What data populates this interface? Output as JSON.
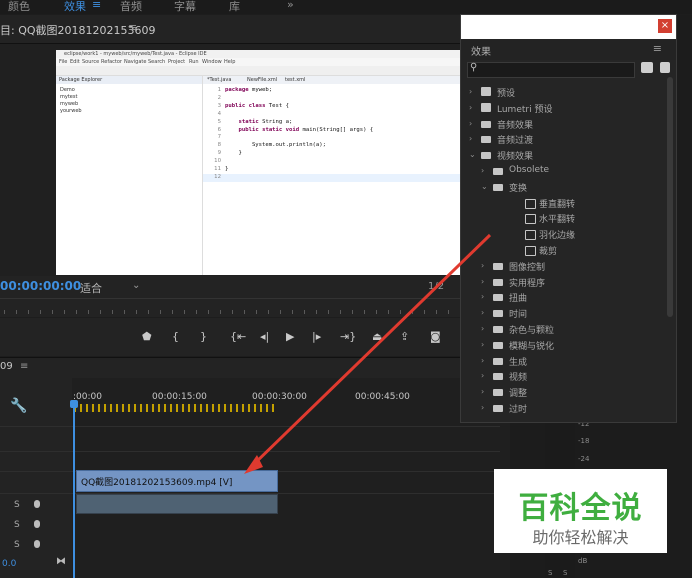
{
  "workspace_tabs": [
    {
      "label": "颜色",
      "active": false
    },
    {
      "label": "效果",
      "active": true
    },
    {
      "label": "音频",
      "active": false
    },
    {
      "label": "字幕",
      "active": false
    },
    {
      "label": "库",
      "active": false
    }
  ],
  "workspace_more": "»",
  "program_monitor": {
    "title": "目: QQ截图20181202153609",
    "menu_icon": "≡",
    "timecode": "00:00:00:00",
    "fit": "适合",
    "ratio": "1/2"
  },
  "eclipse": {
    "title": "eclipse/work1 - myweb/src/myweb/Test.java - Eclipse IDE",
    "menu": [
      "File",
      "Edit",
      "Source",
      "Refactor",
      "Navigate",
      "Search",
      "Project",
      "Run",
      "Window",
      "Help"
    ],
    "package_explorer": "Package Explorer",
    "projects": [
      "Demo",
      "mytest",
      "myweb",
      "yourweb"
    ],
    "tabs": [
      "*Test.java",
      "NewFile.xml",
      "test.xml"
    ],
    "line_numbers": [
      "1",
      "2",
      "3",
      "4",
      "5",
      "6",
      "7",
      "8",
      "9",
      "10",
      "11",
      "12"
    ],
    "code_lines": [
      "package myweb;",
      "",
      "public class Test {",
      "",
      "    static String a;",
      "    public static void main(String[] args) {",
      "",
      "        System.out.println(a);",
      "    }",
      "",
      "}",
      ""
    ]
  },
  "timeline": {
    "sequence_label": "09",
    "menu_icon": "≡",
    "timestamps": [
      ":00:00",
      "00:00:15:00",
      "00:00:30:00",
      "00:00:45:00"
    ],
    "video_clip": "QQ截图20181202153609.mp4 [V]",
    "track_labels": [
      "S",
      "S",
      "S"
    ],
    "bottom_value": "0.0"
  },
  "effects_panel": {
    "close": "×",
    "title": "效果",
    "menu_icon": "≡",
    "search_placeholder": "",
    "items": [
      {
        "label": "预设",
        "type": "preset",
        "depth": 0,
        "expanded": false
      },
      {
        "label": "Lumetri 预设",
        "type": "preset",
        "depth": 0,
        "expanded": false
      },
      {
        "label": "音频效果",
        "type": "folder",
        "depth": 0,
        "expanded": false
      },
      {
        "label": "音频过渡",
        "type": "folder",
        "depth": 0,
        "expanded": false
      },
      {
        "label": "视频效果",
        "type": "folder",
        "depth": 0,
        "expanded": true
      },
      {
        "label": "Obsolete",
        "type": "folder",
        "depth": 1,
        "expanded": false
      },
      {
        "label": "变换",
        "type": "folder",
        "depth": 1,
        "expanded": true
      },
      {
        "label": "垂直翻转",
        "type": "effect",
        "depth": 2
      },
      {
        "label": "水平翻转",
        "type": "effect",
        "depth": 2
      },
      {
        "label": "羽化边缘",
        "type": "effect",
        "depth": 2
      },
      {
        "label": "裁剪",
        "type": "effect",
        "depth": 2
      },
      {
        "label": "图像控制",
        "type": "folder",
        "depth": 1,
        "expanded": false
      },
      {
        "label": "实用程序",
        "type": "folder",
        "depth": 1,
        "expanded": false
      },
      {
        "label": "扭曲",
        "type": "folder",
        "depth": 1,
        "expanded": false
      },
      {
        "label": "时间",
        "type": "folder",
        "depth": 1,
        "expanded": false
      },
      {
        "label": "杂色与颗粒",
        "type": "folder",
        "depth": 1,
        "expanded": false
      },
      {
        "label": "模糊与锐化",
        "type": "folder",
        "depth": 1,
        "expanded": false
      },
      {
        "label": "生成",
        "type": "folder",
        "depth": 1,
        "expanded": false
      },
      {
        "label": "视频",
        "type": "folder",
        "depth": 1,
        "expanded": false
      },
      {
        "label": "调整",
        "type": "folder",
        "depth": 1,
        "expanded": false
      },
      {
        "label": "过时",
        "type": "folder",
        "depth": 1,
        "expanded": false
      }
    ]
  },
  "audio_meter": {
    "ticks": [
      "-12",
      "-18",
      "-24",
      "dB"
    ],
    "solo": [
      "S",
      "S"
    ]
  },
  "watermark": {
    "main": "百科全说",
    "sub": "助你轻松解决"
  },
  "colors": {
    "accent": "#3e8fe0",
    "clip_video": "#7495c4",
    "arrow": "#e03a2f",
    "watermark_green": "#3fae3f"
  }
}
